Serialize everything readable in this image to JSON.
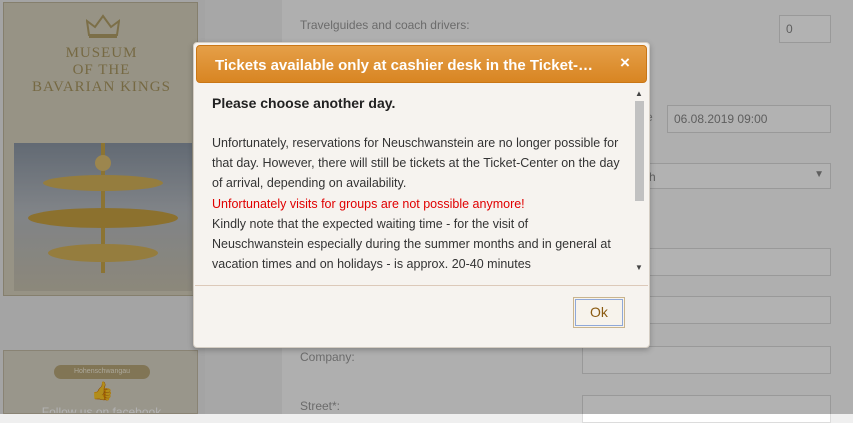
{
  "left_panel": {
    "museum_title_lines": [
      "Museum",
      "of the",
      "Bavarian Kings"
    ],
    "facebook_banner": "Hohenschwangau",
    "facebook_text": "Follow us on facebook"
  },
  "form": {
    "travelguides_label": "Travelguides and coach drivers:",
    "travelguides_value": "0",
    "date_label_fragment": "e",
    "date_value": "06.08.2019 09:00",
    "select_fragment": "h",
    "company_label": "Company:",
    "street_label": "Street*:"
  },
  "dialog": {
    "title": "Tickets available only at cashier desk in the Ticket-Center",
    "close_glyph": "×",
    "heading": "Please choose another day.",
    "paragraph1": "Unfortunately, reservations for Neuschwanstein are no longer possible for that day. However, there will still be tickets at the Ticket-Center on the day of arrival, depending on availability.",
    "warning": "Unfortunately visits for groups are not possible anymore!",
    "paragraph2": "Kindly note that the expected waiting time - for the visit of Neuschwanstein especially during the summer months and in general at vacation times and on holidays - is approx. 20-40 minutes",
    "ok_label": "Ok",
    "scroll_up_glyph": "▲",
    "scroll_down_glyph": "▼"
  },
  "colors": {
    "title_bar": "#dd8c2c",
    "warning_text": "#e00000",
    "overlay": "rgba(0,0,0,0.30)"
  }
}
